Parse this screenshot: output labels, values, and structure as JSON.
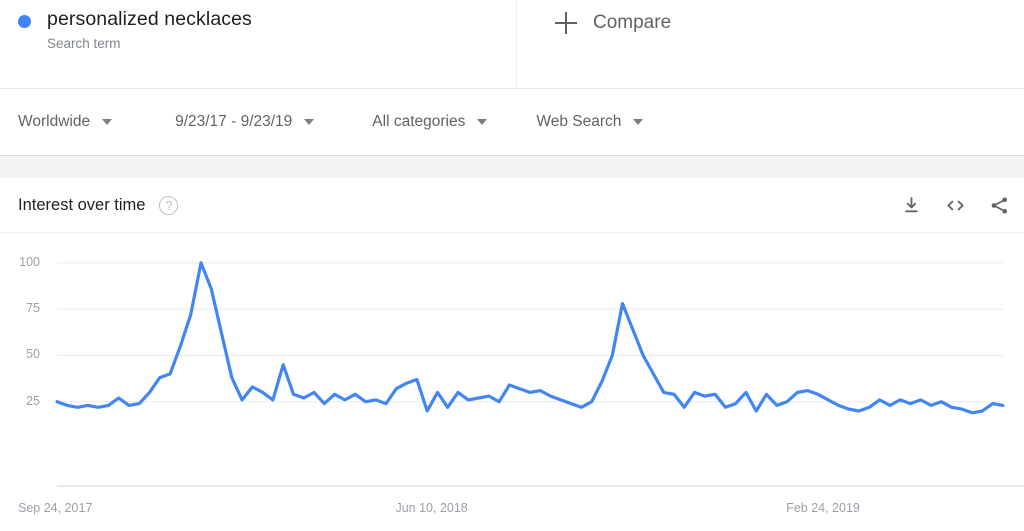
{
  "term": {
    "title": "personalized necklaces",
    "subtitle": "Search term",
    "dot_color": "#4285f4"
  },
  "compare": {
    "label": "Compare",
    "icon": "plus-icon"
  },
  "filters": [
    {
      "label": "Worldwide",
      "name": "location-filter"
    },
    {
      "label": "9/23/17 - 9/23/19",
      "name": "date-range-filter"
    },
    {
      "label": "All categories",
      "name": "category-filter"
    },
    {
      "label": "Web Search",
      "name": "search-type-filter"
    }
  ],
  "card": {
    "title": "Interest over time",
    "help_icon": "question-mark-icon",
    "actions": [
      {
        "name": "download-icon",
        "label": "Download"
      },
      {
        "name": "embed-code-icon",
        "label": "Embed"
      },
      {
        "name": "share-icon",
        "label": "Share"
      }
    ]
  },
  "chart_data": {
    "type": "line",
    "title": "Interest over time",
    "xlabel": "",
    "ylabel": "",
    "ylim": [
      0,
      108
    ],
    "yticks": [
      25,
      50,
      75,
      100
    ],
    "grid": true,
    "legend": "none",
    "line_color": "#4285f4",
    "x_tick_labels": [
      "Sep 24, 2017",
      "Jun 10, 2018",
      "Feb 24, 2019"
    ],
    "x_tick_positions": [
      0,
      37,
      75
    ],
    "series": [
      {
        "name": "personalized necklaces",
        "values": [
          25,
          23,
          22,
          23,
          22,
          23,
          27,
          23,
          24,
          30,
          38,
          40,
          55,
          72,
          100,
          86,
          62,
          38,
          26,
          33,
          30,
          26,
          45,
          29,
          27,
          30,
          24,
          29,
          26,
          29,
          25,
          26,
          24,
          32,
          35,
          37,
          20,
          30,
          22,
          30,
          26,
          27,
          28,
          25,
          34,
          32,
          30,
          31,
          28,
          26,
          24,
          22,
          25,
          36,
          50,
          78,
          64,
          50,
          40,
          30,
          29,
          22,
          30,
          28,
          29,
          22,
          24,
          30,
          20,
          29,
          23,
          25,
          30,
          31,
          29,
          26,
          23,
          21,
          20,
          22,
          26,
          23,
          26,
          24,
          26,
          23,
          25,
          22,
          21,
          19,
          20,
          24,
          23
        ]
      }
    ]
  }
}
